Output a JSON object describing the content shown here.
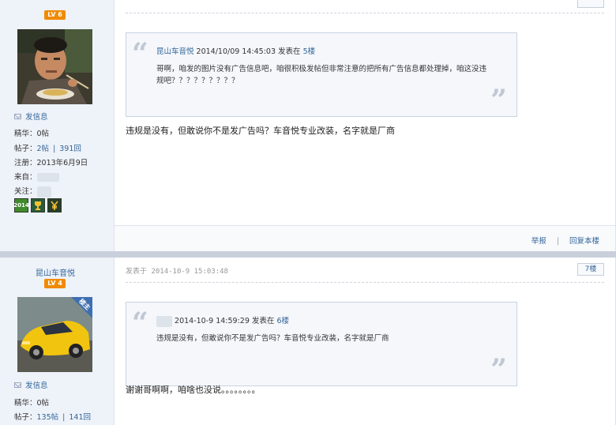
{
  "post1": {
    "level": "LV 6",
    "send_message": "发信息",
    "stats": {
      "essence_label": "精华：",
      "essence_value": "0帖",
      "posts_label": "帖子：",
      "posts_value": "2帖",
      "replies_value": "391回",
      "registered": "注册：2013年6月9日",
      "from_label": "来自：",
      "follow_label": "关注："
    },
    "medals": [
      "2014",
      "trophy-icon",
      "yen-icon"
    ],
    "quote": {
      "author": "昆山车音悦",
      "datetime": "2014/10/09 14:45:03",
      "posted_at": "发表在",
      "floor": "5楼",
      "text": "哥啊，咱发的图片没有广告信息吧，咱很积极发帖但非常注意的把所有广告信息都处理掉，咱这没违规吧？？？？？？？？？"
    },
    "content": "违规是没有，但敢说你不是发广告吗？车音悦专业改装，名字就是厂商",
    "footer": {
      "report": "举报",
      "reply": "回复本楼"
    }
  },
  "post2": {
    "username": "昆山车音悦",
    "level": "LV 4",
    "badge": "楼主",
    "send_message": "发信息",
    "stats": {
      "essence_label": "精华：",
      "essence_value": "0帖",
      "posts_label": "帖子：",
      "posts_value": "135帖",
      "replies_value": "141回"
    },
    "posted_label": "发表于",
    "posted_time": "2014-10-9 15:03:48",
    "floor_button": "7楼",
    "quote": {
      "datetime": "2014-10-9 14:59:29",
      "posted_at": "发表在",
      "floor": "6楼",
      "text": "违规是没有，但敢说你不是发广告吗？车音悦专业改装，名字就是厂商"
    },
    "content": "谢谢哥啊啊，咱啥也没说。。。。。。。。"
  },
  "colors": {
    "link": "#336699",
    "level_badge": "#f08a00",
    "sidebar": "#eef2f9",
    "divider": "#c9d0dc"
  }
}
